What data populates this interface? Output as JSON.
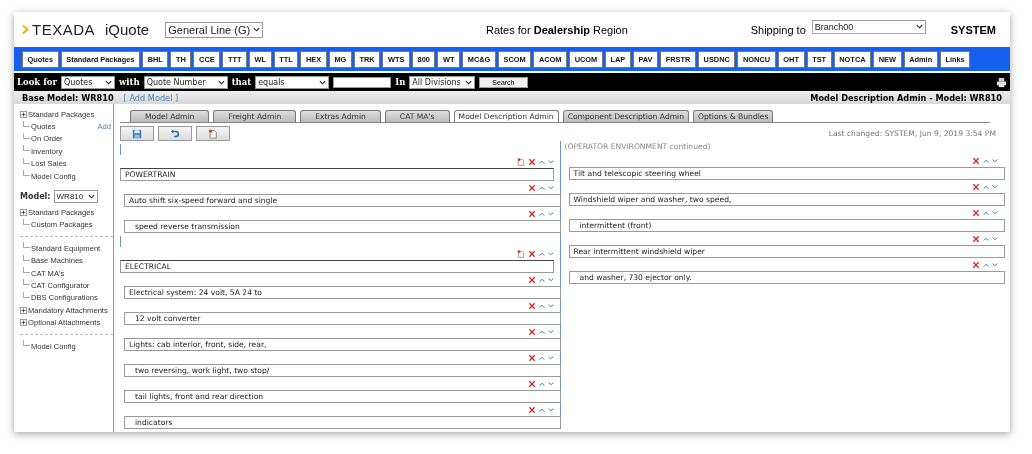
{
  "header": {
    "logo": "TEXADA",
    "app": "iQuote",
    "line_select": "General Line (G)",
    "rates": "Rates for **Dealership** Region",
    "shipping_label": "Shipping to",
    "shipping_select": "Branch00",
    "user": "SYSTEM"
  },
  "nav": [
    "Quotes",
    "Standard Packages",
    "BHL",
    "TH",
    "CCE",
    "TTT",
    "WL",
    "TTL",
    "HEX",
    "MG",
    "TRK",
    "WTS",
    "800",
    "WT",
    "MC&G",
    "SCOM",
    "ACOM",
    "UCOM",
    "LAP",
    "PAV",
    "FRSTR",
    "USDNC",
    "NONCU",
    "OHT",
    "TST",
    "NOTCA",
    "NEW",
    "Admin",
    "Links"
  ],
  "search": {
    "look_for_label": "Look for",
    "look_for": "Quotes",
    "with_label": "with",
    "with": "Quote Number",
    "that_label": "that",
    "that": "equals",
    "in_label": "In",
    "in": "All Divisions",
    "button": "Search"
  },
  "context_bar": {
    "base_model": "Base Model: WR810",
    "add_model": "[ Add Model ]",
    "page_title": "Model Description Admin - Model: WR810"
  },
  "sidebar": {
    "top": [
      {
        "label": "Standard Packages",
        "expandable": true
      },
      {
        "label": "Quotes",
        "expandable": false,
        "action": "Add"
      },
      {
        "label": "On Order",
        "expandable": false
      },
      {
        "label": "Inventory",
        "expandable": false
      },
      {
        "label": "Lost Sales",
        "expandable": false
      },
      {
        "label": "Model Config",
        "expandable": false
      }
    ],
    "model_label": "Model:",
    "model_select": "WR810",
    "groups": [
      [
        {
          "label": "Standard Packages",
          "expandable": true
        },
        {
          "label": "Custom Packages",
          "expandable": false
        }
      ],
      [
        {
          "label": "Standard Equipment",
          "expandable": false
        },
        {
          "label": "Base Machines",
          "expandable": false
        },
        {
          "label": "CAT MA's",
          "expandable": false
        },
        {
          "label": "CAT Configurator",
          "expandable": false
        },
        {
          "label": "DBS Configurations",
          "expandable": false
        },
        {
          "label": "Mandatory Attachments",
          "expandable": true
        },
        {
          "label": "Optional Attachments",
          "expandable": true
        }
      ],
      [
        {
          "label": "Model Config",
          "expandable": false
        }
      ]
    ]
  },
  "tabs": [
    {
      "label": "Model Admin",
      "selected": false
    },
    {
      "label": "Freight Admin",
      "selected": false
    },
    {
      "label": "Extras Admin",
      "selected": false
    },
    {
      "label": "CAT MA's",
      "selected": false
    },
    {
      "label": "Model Description Admin",
      "selected": true
    },
    {
      "label": "Component Description Admin",
      "selected": false
    },
    {
      "label": "Options & Bundles",
      "selected": false
    }
  ],
  "last_changed": "Last changed: SYSTEM, Jun 9, 2019 3:54 PM",
  "left_column": [
    {
      "kind": "header",
      "text": "POWERTRAIN"
    },
    {
      "kind": "line",
      "text": "Auto shift six-speed forward and single",
      "indented": false
    },
    {
      "kind": "line",
      "text": "speed reverse transmission",
      "indented": true
    },
    {
      "kind": "header",
      "text": "ELECTRICAL"
    },
    {
      "kind": "line",
      "text": "Electrical system: 24 volt, 5A 24 to",
      "indented": false
    },
    {
      "kind": "line",
      "text": "12 volt converter",
      "indented": true
    },
    {
      "kind": "line",
      "text": "Lights: cab interior, front, side, rear,",
      "indented": false
    },
    {
      "kind": "line",
      "text": "two reversing, work light, two stop/",
      "indented": true
    },
    {
      "kind": "line",
      "text": "tail lights, front and rear direction",
      "indented": true
    },
    {
      "kind": "line",
      "text": "indicators",
      "indented": true
    }
  ],
  "right_column": {
    "note": "(OPERATOR ENVIRONMENT continued)",
    "lines": [
      {
        "kind": "line",
        "text": "Tilt and telescopic steering wheel",
        "indented": false
      },
      {
        "kind": "line",
        "text": "Windshield wiper and washer, two speed,",
        "indented": false
      },
      {
        "kind": "line",
        "text": "intermittent (front)",
        "indented": true
      },
      {
        "kind": "line",
        "text": "Rear intermittent windshield wiper",
        "indented": false
      },
      {
        "kind": "line",
        "text": "and washer, 730 ejector only.",
        "indented": true
      }
    ]
  }
}
